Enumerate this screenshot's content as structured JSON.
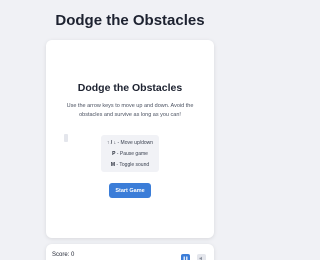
{
  "page": {
    "title": "Dodge the Obstacles"
  },
  "menu": {
    "title": "Dodge the Obstacles",
    "description": "Use the arrow keys to move up and down. Avoid the obstacles and survive as long as you can!",
    "controls": [
      {
        "key": "↑ / ↓",
        "action": "Move up/down"
      },
      {
        "key": "P",
        "action": "Pause game"
      },
      {
        "key": "M",
        "action": "Toggle sound"
      }
    ],
    "start_label": "Start Game"
  },
  "status": {
    "score_label": "Score: 0",
    "pause_icon": "pause-icon",
    "sound_icon": "sound-icon"
  },
  "colors": {
    "accent": "#3b7dd8",
    "background": "#f0f1f5",
    "card": "#ffffff"
  }
}
